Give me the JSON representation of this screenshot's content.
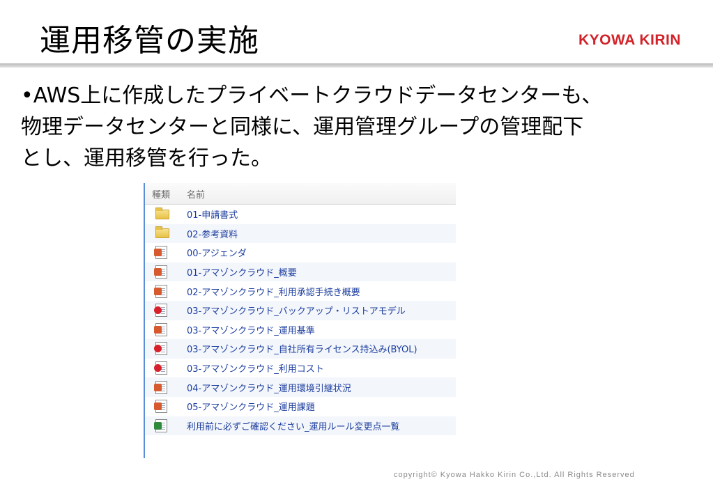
{
  "title": "運用移管の実施",
  "brand": "KYOWA KIRIN",
  "body_lines": [
    "•AWS上に作成したプライベートクラウドデータセンターも、",
    "物理データセンターと同様に、運用管理グループの管理配下",
    "とし、運用移管を行った。"
  ],
  "file_list": {
    "headers": {
      "type": "種類",
      "name": "名前"
    },
    "items": [
      {
        "icon": "folder-icon",
        "name": "01-申請書式"
      },
      {
        "icon": "folder-icon",
        "name": "02-参考資料"
      },
      {
        "icon": "ppt-icon",
        "name": "00-アジェンダ"
      },
      {
        "icon": "ppt-icon",
        "name": "01-アマゾンクラウド_概要"
      },
      {
        "icon": "ppt-icon",
        "name": "02-アマゾンクラウド_利用承認手続き概要"
      },
      {
        "icon": "pdf-icon",
        "name": "03-アマゾンクラウド_バックアップ・リストアモデル"
      },
      {
        "icon": "ppt-icon",
        "name": "03-アマゾンクラウド_運用基準"
      },
      {
        "icon": "pdf-icon",
        "name": "03-アマゾンクラウド_自社所有ライセンス持込み(BYOL)"
      },
      {
        "icon": "pdf-icon",
        "name": "03-アマゾンクラウド_利用コスト"
      },
      {
        "icon": "ppt-icon",
        "name": "04-アマゾンクラウド_運用環境引継状況"
      },
      {
        "icon": "ppt-icon",
        "name": "05-アマゾンクラウド_運用課題"
      },
      {
        "icon": "xls-icon",
        "name": "利用前に必ずご確認ください_運用ルール変更点一覧"
      }
    ]
  },
  "copyright": "copyright© Kyowa Hakko Kirin Co.,Ltd. All Rights Reserved"
}
